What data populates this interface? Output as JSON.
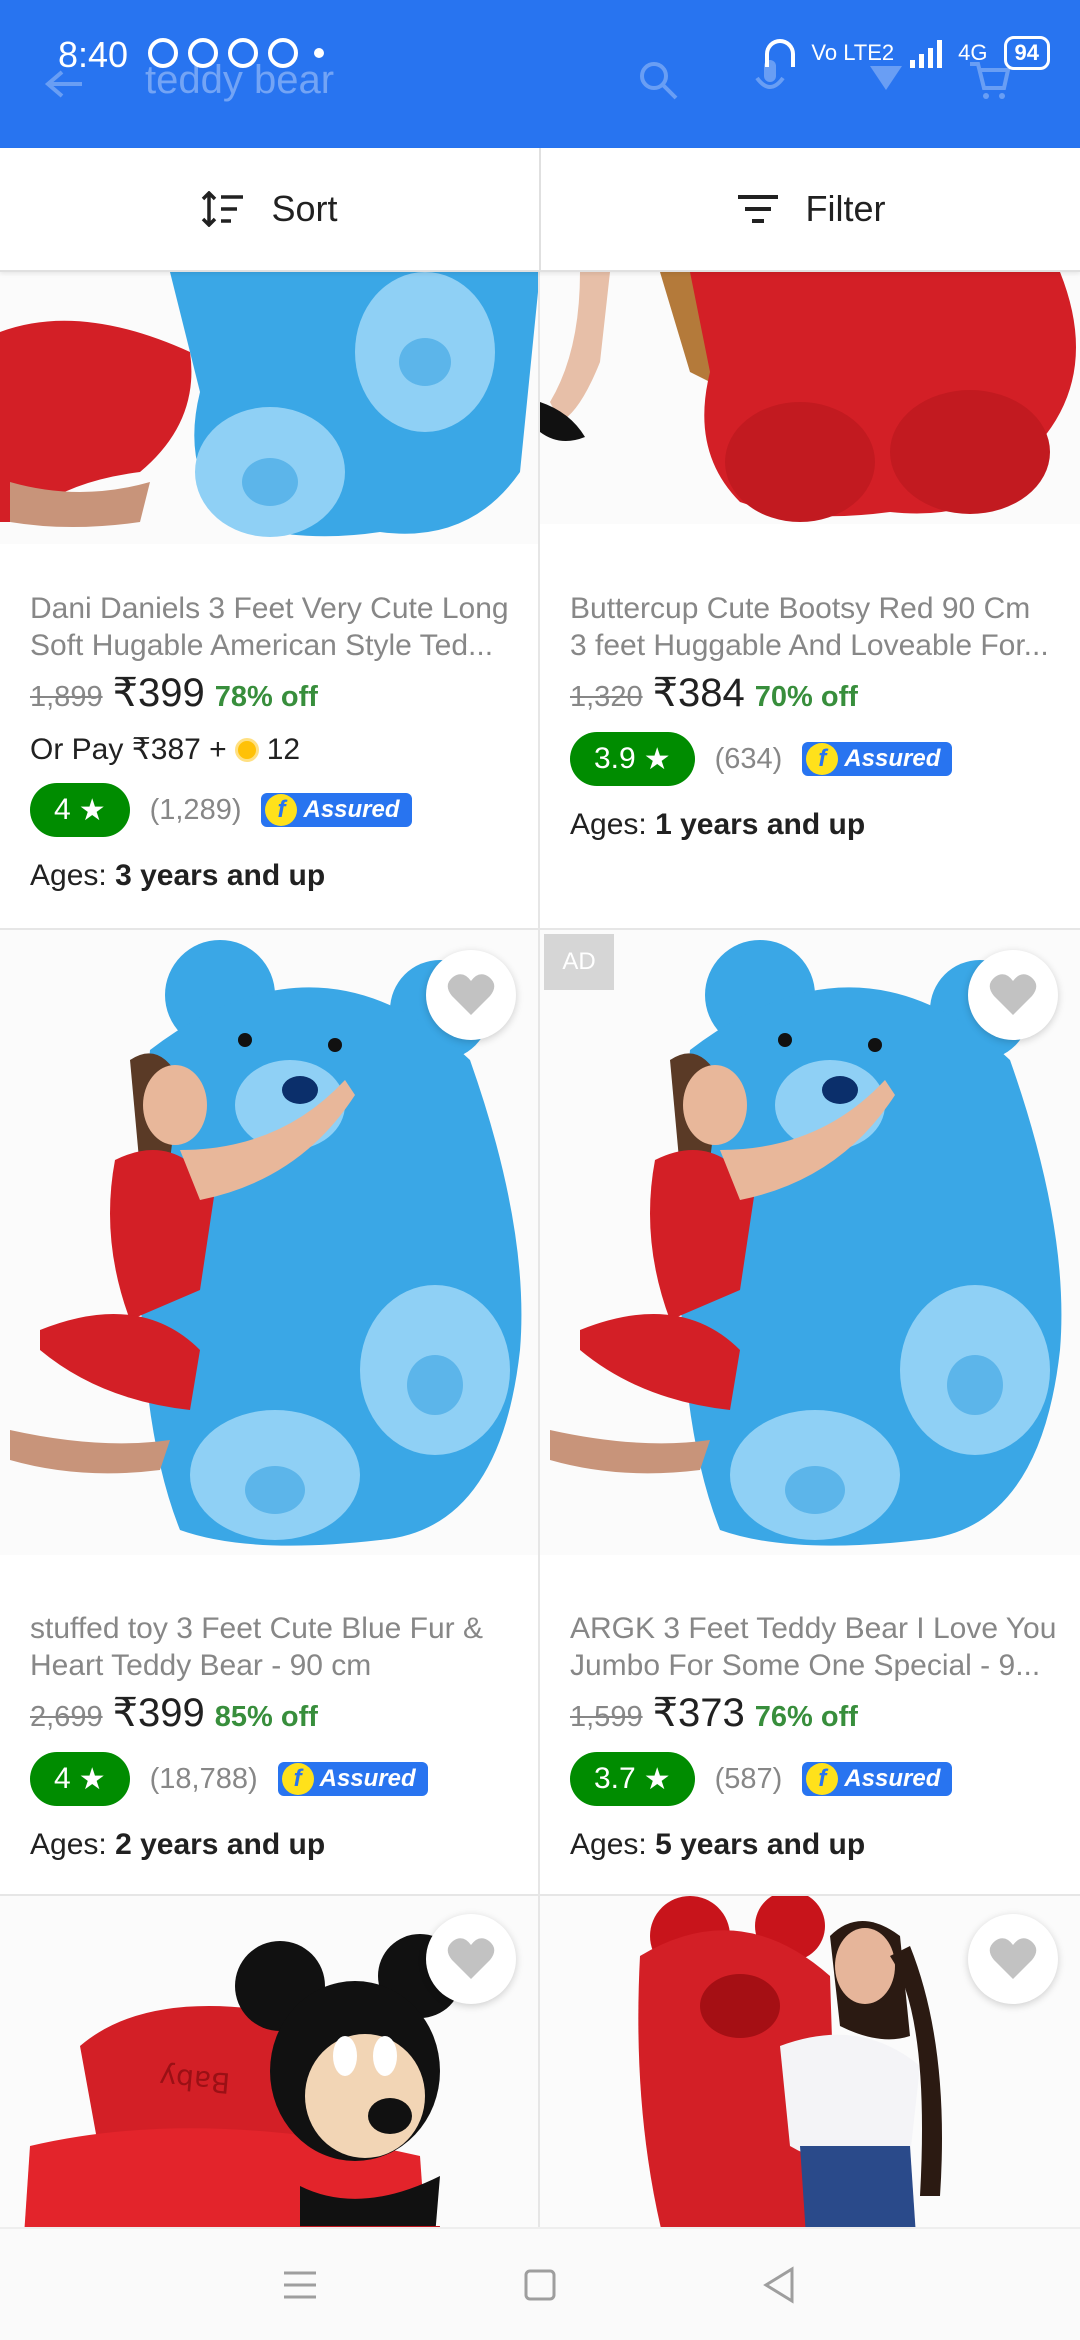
{
  "status_bar": {
    "time": "8:40",
    "network": "Vo LTE2",
    "signal_label": "4G",
    "battery": "94"
  },
  "header": {
    "search_text": "teddy bear"
  },
  "toolbar": {
    "sort_label": "Sort",
    "filter_label": "Filter"
  },
  "products": [
    {
      "title_line1": "Dani Daniels 3 Feet Very Cute Long",
      "title_line2": "Soft Hugable American Style Ted...",
      "mrp": "1,899",
      "price": "₹399",
      "discount": "78% off",
      "or_pay": "Or Pay ₹387 +",
      "coins": "12",
      "rating": "4",
      "rating_count": "(1,289)",
      "assured": "Assured",
      "ages_label": "Ages:",
      "ages_value": "3 years and up"
    },
    {
      "title_line1": "Buttercup Cute Bootsy Red 90 Cm",
      "title_line2": "3 feet Huggable And Loveable For...",
      "mrp": "1,320",
      "price": "₹384",
      "discount": "70% off",
      "rating": "3.9",
      "rating_count": "(634)",
      "assured": "Assured",
      "ages_label": "Ages:",
      "ages_value": "1 years and up"
    },
    {
      "title_line1": "stuffed toy 3 Feet Cute Blue Fur &",
      "title_line2": "Heart Teddy Bear  - 90 cm",
      "mrp": "2,699",
      "price": "₹399",
      "discount": "85% off",
      "rating": "4",
      "rating_count": "(18,788)",
      "assured": "Assured",
      "ages_label": "Ages:",
      "ages_value": "2 years and up"
    },
    {
      "ad_label": "AD",
      "title_line1": "ARGK 3 Feet Teddy Bear I Love You",
      "title_line2": "Jumbo For Some One Special - 9...",
      "mrp": "1,599",
      "price": "₹373",
      "discount": "76% off",
      "rating": "3.7",
      "rating_count": "(587)",
      "assured": "Assured",
      "ages_label": "Ages:",
      "ages_value": "5 years and up"
    },
    {
      "image_text": "Baby"
    },
    {}
  ],
  "colors": {
    "brand_blue": "#2874f0",
    "rating_green": "#008c00",
    "discount_green": "#388e3c",
    "assured_yellow": "#ffe11b"
  },
  "icons": [
    "back-arrow-icon",
    "search-icon",
    "microphone-icon",
    "notification-icon",
    "cart-icon",
    "sort-icon",
    "filter-icon",
    "heart-icon",
    "star-icon",
    "coin-icon",
    "menu-icon",
    "home-square-icon",
    "back-triangle-icon"
  ]
}
